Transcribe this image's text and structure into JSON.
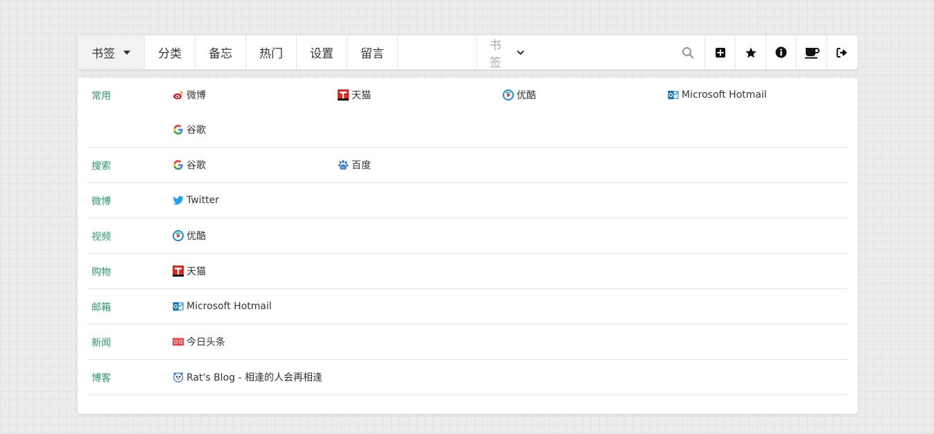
{
  "nav": {
    "items": [
      {
        "name": "bookmarks",
        "label": "书签",
        "width": 97
      },
      {
        "name": "categories",
        "label": "分类",
        "width": 73
      },
      {
        "name": "memo",
        "label": "备忘",
        "width": 73
      },
      {
        "name": "hot",
        "label": "热门",
        "width": 73
      },
      {
        "name": "settings",
        "label": "设置",
        "width": 73
      },
      {
        "name": "messages",
        "label": "留言",
        "width": 73
      }
    ],
    "search_scope": "书签",
    "search_placeholder": ""
  },
  "toolbar": [
    "plus-square-icon",
    "star-icon",
    "info-circle-icon",
    "coffee-icon",
    "sign-out-icon"
  ],
  "categories": [
    {
      "name": "常用",
      "links": [
        {
          "icon": "weibo",
          "label": "微博"
        },
        {
          "icon": "tmall",
          "label": "天猫"
        },
        {
          "icon": "youku",
          "label": "优酷"
        },
        {
          "icon": "outlook",
          "label": "Microsoft Hotmail"
        },
        {
          "icon": "google",
          "label": "谷歌"
        }
      ]
    },
    {
      "name": "搜索",
      "links": [
        {
          "icon": "google",
          "label": "谷歌"
        },
        {
          "icon": "baidu",
          "label": "百度"
        }
      ]
    },
    {
      "name": "微博",
      "links": [
        {
          "icon": "twitter",
          "label": "Twitter"
        }
      ]
    },
    {
      "name": "视频",
      "links": [
        {
          "icon": "youku",
          "label": "优酷"
        }
      ]
    },
    {
      "name": "购物",
      "links": [
        {
          "icon": "tmall",
          "label": "天猫"
        }
      ]
    },
    {
      "name": "邮箱",
      "links": [
        {
          "icon": "outlook",
          "label": "Microsoft Hotmail"
        }
      ]
    },
    {
      "name": "新闻",
      "links": [
        {
          "icon": "toutiao",
          "label": "今日头条"
        }
      ]
    },
    {
      "name": "博客",
      "links": [
        {
          "icon": "blog",
          "label": "Rat's Blog - 相逢的人会再相逢"
        }
      ]
    }
  ]
}
